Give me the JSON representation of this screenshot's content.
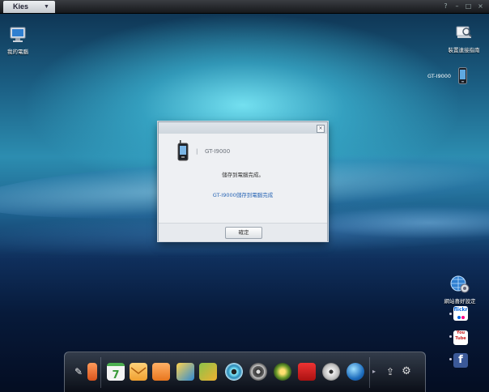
{
  "app": {
    "title": "Kies"
  },
  "desktop": {
    "my_computer_label": "我的電腦",
    "connection_guide_label": "裝置連接指南",
    "device_name": "GT-I9000",
    "web_settings_label": "網站喜好設定"
  },
  "dialog": {
    "device_name": "GT-I9000",
    "separator": "|",
    "message": "儲存到電腦完成。",
    "detail": "GT-I9000儲存到電腦完成",
    "ok_label": "確定",
    "close_glyph": "×"
  },
  "side_links": {
    "flickr": "flickr",
    "youtube": "You Tube",
    "facebook": "f"
  },
  "dock": {
    "calendar_day": "7",
    "items": [
      "memo",
      "calendar",
      "messages",
      "notes",
      "photos",
      "photo-edit",
      "music",
      "video",
      "podcast",
      "tools",
      "disc",
      "globe",
      "transfer",
      "settings"
    ]
  },
  "colors": {
    "accent": "#2a66b5",
    "youtube": "#cc1f1f",
    "facebook": "#3b5998"
  }
}
